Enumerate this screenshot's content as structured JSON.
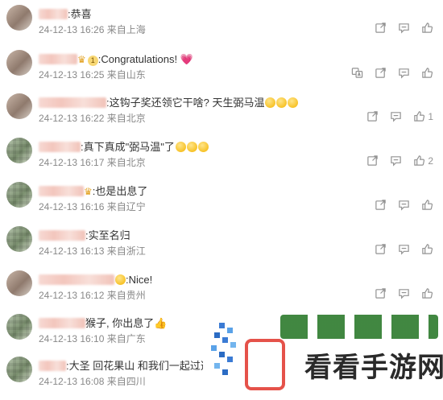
{
  "comments": [
    {
      "text": ":恭喜",
      "time": "24-12-13 16:26",
      "location": "来自上海",
      "likes": "",
      "extras": ""
    },
    {
      "text": ":Congratulations! ",
      "time": "24-12-13 16:25",
      "location": "来自山东",
      "likes": "",
      "badge": "1",
      "extras": "heart"
    },
    {
      "text": ":这钩子奖还领它干啥? 天生弼马温",
      "time": "24-12-13 16:22",
      "location": "来自北京",
      "likes": "1",
      "extras": "emoji3"
    },
    {
      "text": ":真下真成\"弼马温\"了",
      "time": "24-12-13 16:17",
      "location": "来自北京",
      "likes": "2",
      "extras": "emoji3"
    },
    {
      "text": ":也是出息了",
      "time": "24-12-13 16:16",
      "location": "来自辽宁",
      "likes": "",
      "extras": "crown"
    },
    {
      "text": ":实至名归",
      "time": "24-12-13 16:13",
      "location": "来自浙江",
      "likes": "",
      "extras": ""
    },
    {
      "text": ":Nice!",
      "time": "24-12-13 16:12",
      "location": "来自贵州",
      "likes": "",
      "extras": "emoji1"
    },
    {
      "text": "猴子, 你出息了",
      "time": "24-12-13 16:10",
      "location": "来自广东",
      "likes": "",
      "extras": "thumb"
    },
    {
      "text": ":大圣 回花果山 和我们一起过逍遥",
      "time": "24-12-13 16:08",
      "location": "来自四川",
      "likes": "",
      "extras": ""
    }
  ],
  "icons": {
    "share": "share-icon",
    "comment": "comment-icon",
    "like": "thumbs-up-icon",
    "translate": "translate-icon"
  },
  "watermark": {
    "text": "看看手游网"
  }
}
